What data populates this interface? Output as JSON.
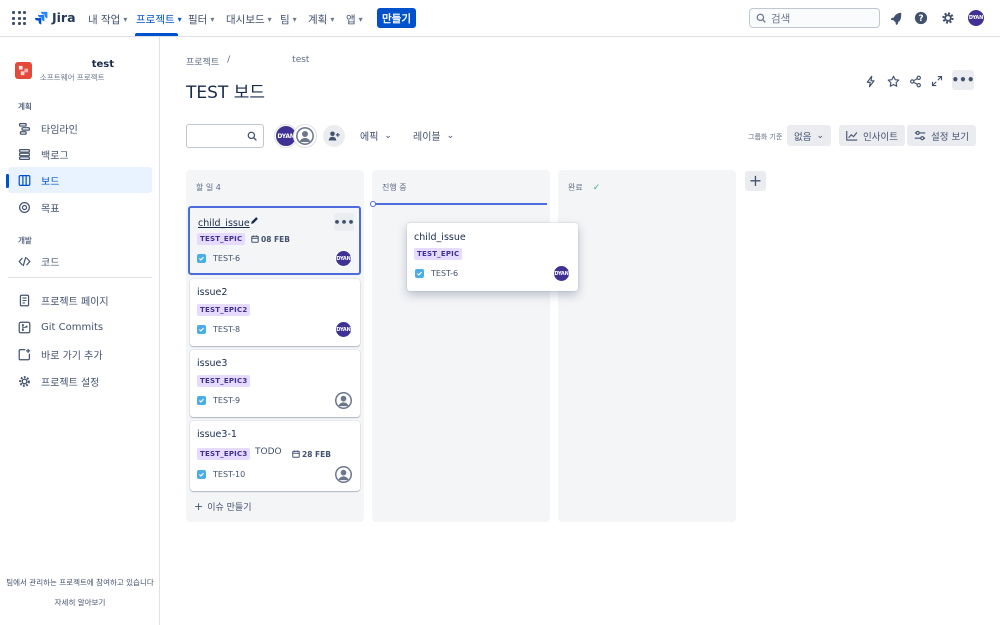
{
  "app": {
    "name": "Jira"
  },
  "topnav": {
    "items": [
      {
        "label": "내 작업"
      },
      {
        "label": "프로젝트"
      },
      {
        "label": "필터"
      },
      {
        "label": "대시보드"
      },
      {
        "label": "팀"
      },
      {
        "label": "계획"
      },
      {
        "label": "앱"
      }
    ],
    "create_label": "만들기",
    "search_placeholder": "검색",
    "user_initials": "DYAN"
  },
  "sidebar": {
    "project_name": "test",
    "project_type": "소프트웨어 프로젝트",
    "section_plan": "계획",
    "section_dev": "개발",
    "items": [
      {
        "label": "타임라인"
      },
      {
        "label": "백로그"
      },
      {
        "label": "보드"
      },
      {
        "label": "목표"
      },
      {
        "label": "코드"
      },
      {
        "label": "프로젝트 페이지"
      },
      {
        "label": "Git Commits"
      },
      {
        "label": "바로 가기 추가"
      },
      {
        "label": "프로젝트 설정"
      }
    ],
    "footer_text": "팀에서 관리하는 프로젝트에 참여하고 있습니다",
    "footer_link": "자세히 알아보기"
  },
  "breadcrumb": {
    "root": "프로젝트",
    "sep": "/",
    "current": "test"
  },
  "page": {
    "title": "TEST 보드"
  },
  "toolbar": {
    "user_initials": "DYAN",
    "epic_label": "에픽",
    "label_label": "레이블",
    "group_by_label": "그룹화 기준",
    "group_value": "없음",
    "insights_label": "인사이트",
    "view_settings_label": "설정 보기"
  },
  "columns": [
    {
      "name": "할 일 4"
    },
    {
      "name": "진행 중"
    },
    {
      "name": "완료"
    }
  ],
  "cards": [
    {
      "title": "child_issue",
      "epic": "TEST_EPIC",
      "due": "08 FEB",
      "key": "TEST-6",
      "assignee": "DYAN"
    },
    {
      "title": "issue2",
      "epic": "TEST_EPIC2",
      "key": "TEST-8",
      "assignee": "DYAN"
    },
    {
      "title": "issue3",
      "epic": "TEST_EPIC3",
      "key": "TEST-9"
    },
    {
      "title": "issue3-1",
      "epic": "TEST_EPIC3",
      "status": "TODO",
      "due": "28 FEB",
      "key": "TEST-10"
    }
  ],
  "drag_card": {
    "title": "child_issue",
    "epic": "TEST_EPIC",
    "key": "TEST-6",
    "assignee": "DYAN"
  },
  "create_issue_label": "이슈 만들기",
  "colors": {
    "accent": "#0052cc",
    "epic_bg": "#e6dbff",
    "epic_text": "#403294",
    "avatar": "#403294"
  }
}
